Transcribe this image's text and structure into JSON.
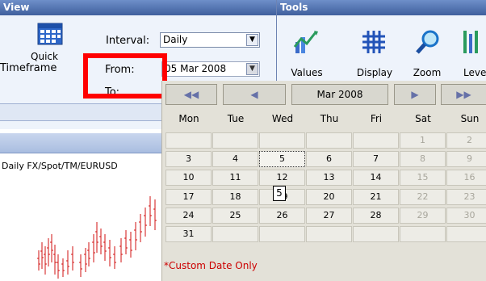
{
  "view": {
    "header": "View",
    "quick_timeframe_label_1": "Quick",
    "quick_timeframe_label_2": "Timeframe",
    "interval_label": "Interval:",
    "interval_value": "Daily",
    "from_label": "From:",
    "from_value": "05 Mar 2008",
    "to_label": "To:"
  },
  "tools": {
    "header": "Tools",
    "values_label": "Values",
    "display_label": "Display",
    "zoom_label": "Zoom",
    "levels_label": "Leve"
  },
  "chart": {
    "title": "Daily FX/Spot/TM/EURUSD"
  },
  "calendar": {
    "month_label": "Mar 2008",
    "prev_year_icon": "double-left-arrow",
    "prev_month_icon": "left-arrow",
    "next_month_icon": "right-arrow",
    "next_year_icon": "double-right-arrow",
    "weekdays": [
      "Mon",
      "Tue",
      "Wed",
      "Thu",
      "Fri",
      "Sat",
      "Sun"
    ],
    "weeks": [
      [
        "",
        "",
        "",
        "",
        "",
        "1",
        "2"
      ],
      [
        "3",
        "4",
        "5",
        "6",
        "7",
        "8",
        "9"
      ],
      [
        "10",
        "11",
        "12",
        "13",
        "14",
        "15",
        "16"
      ],
      [
        "17",
        "18",
        "19",
        "20",
        "21",
        "22",
        "23"
      ],
      [
        "24",
        "25",
        "26",
        "27",
        "28",
        "29",
        "30"
      ],
      [
        "31",
        "",
        "",
        "",
        "",
        "",
        ""
      ]
    ],
    "selected_day": "5",
    "tooltip": "5",
    "footer": "*Custom Date Only",
    "footer_color": "#cc0000"
  },
  "highlight_color": "#ff0000"
}
